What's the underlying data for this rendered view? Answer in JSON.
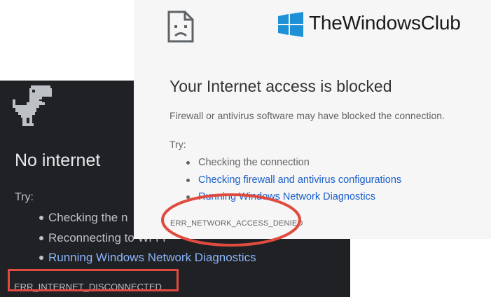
{
  "dark_page": {
    "title": "No internet",
    "try_label": "Try:",
    "suggestions": [
      {
        "text": "Checking the n"
      },
      {
        "text": "Reconnecting to Wi-Fi"
      },
      {
        "text": "Running Windows Network Diagnostics"
      }
    ],
    "error_code": "ERR_INTERNET_DISCONNECTED",
    "icon": "dinosaur-icon",
    "background": "#202124",
    "link_color": "#8ab4f8"
  },
  "light_page": {
    "title": "Your Internet access is blocked",
    "subtitle": "Firewall or antivirus software may have blocked the connection.",
    "try_label": "Try:",
    "suggestions": [
      {
        "text": "Checking the connection"
      },
      {
        "text": "Checking firewall and antivirus configurations"
      },
      {
        "text": "Running Windows Network Diagnostics"
      }
    ],
    "error_code": "ERR_NETWORK_ACCESS_DENIED",
    "icon": "sad-document-icon",
    "background": "#f6f6f6",
    "link_color": "#1a5fcb"
  },
  "watermark": {
    "text": "TheWindowsClub",
    "icon": "windows-logo-icon",
    "color": "#1e90d6"
  },
  "annotation": {
    "color": "#e04b3f"
  }
}
